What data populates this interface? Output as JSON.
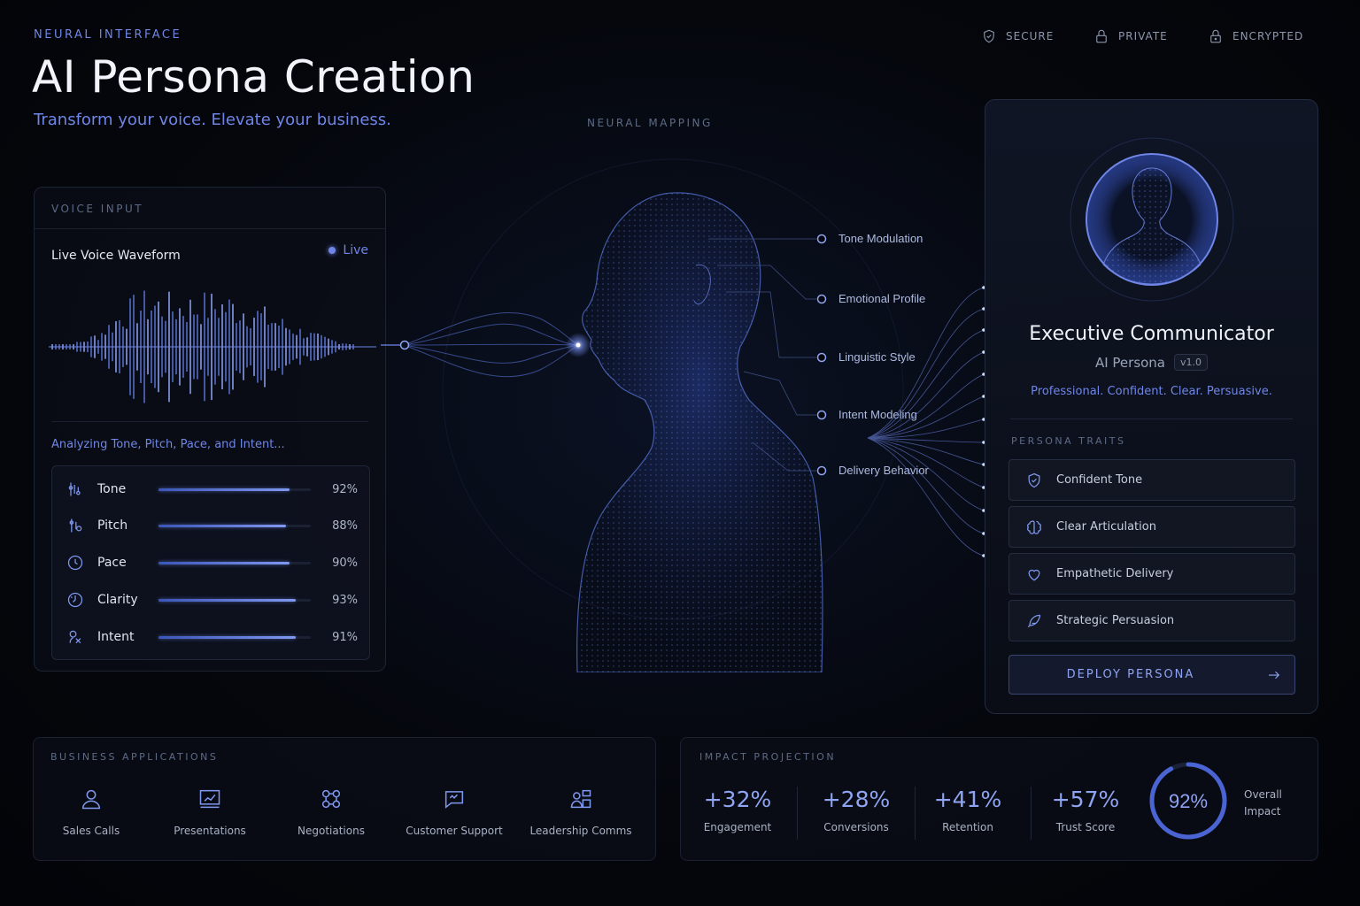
{
  "header": {
    "eyebrow": "NEURAL INTERFACE",
    "title": "AI Persona Creation",
    "subtitle": "Transform your voice. Elevate your business.",
    "badges": [
      {
        "label": "SECURE",
        "icon": "shield-icon"
      },
      {
        "label": "PRIVATE",
        "icon": "lock-icon"
      },
      {
        "label": "ENCRYPTED",
        "icon": "lock-icon"
      }
    ]
  },
  "voice_input": {
    "section_label": "VOICE INPUT",
    "title": "Live Voice Waveform",
    "live_label": "Live",
    "analyzing_text": "Analyzing Tone, Pitch, Pace, and Intent...",
    "metrics": [
      {
        "label": "Tone",
        "value": "92%",
        "level": 0.86,
        "icon": "tuning-icon"
      },
      {
        "label": "Pitch",
        "value": "88%",
        "level": 0.84,
        "icon": "pitch-icon"
      },
      {
        "label": "Pace",
        "value": "90%",
        "level": 0.86,
        "icon": "clock-icon"
      },
      {
        "label": "Clarity",
        "value": "93%",
        "level": 0.9,
        "icon": "clarity-icon"
      },
      {
        "label": "Intent",
        "value": "91%",
        "level": 0.9,
        "icon": "intent-icon"
      }
    ]
  },
  "neural_mapping": {
    "label": "NEURAL MAPPING",
    "nodes": [
      "Tone Modulation",
      "Emotional Profile",
      "Linguistic Style",
      "Intent Modeling",
      "Delivery Behavior"
    ]
  },
  "persona": {
    "name": "Executive Communicator",
    "type": "AI Persona",
    "version": "v1.0",
    "tagline": "Professional. Confident. Clear. Persuasive.",
    "traits_label": "PERSONA TRAITS",
    "traits": [
      {
        "label": "Confident Tone",
        "icon": "shield-check-icon"
      },
      {
        "label": "Clear Articulation",
        "icon": "brain-icon"
      },
      {
        "label": "Empathetic Delivery",
        "icon": "heart-hand-icon"
      },
      {
        "label": "Strategic Persuasion",
        "icon": "feather-icon"
      }
    ],
    "deploy_label": "DEPLOY PERSONA"
  },
  "business_applications": {
    "label": "BUSINESS APPLICATIONS",
    "items": [
      {
        "label": "Sales Calls",
        "icon": "user-icon"
      },
      {
        "label": "Presentations",
        "icon": "presentation-icon"
      },
      {
        "label": "Negotiations",
        "icon": "network-icon"
      },
      {
        "label": "Customer Support",
        "icon": "chat-bubble-icon"
      },
      {
        "label": "Leadership Comms",
        "icon": "leader-icon"
      }
    ]
  },
  "impact_projection": {
    "label": "IMPACT PROJECTION",
    "stats": [
      {
        "value": "+32%",
        "label": "Engagement"
      },
      {
        "value": "+28%",
        "label": "Conversions"
      },
      {
        "value": "+41%",
        "label": "Retention"
      },
      {
        "value": "+57%",
        "label": "Trust Score"
      }
    ],
    "overall_value": "92%",
    "overall_fraction": 0.92,
    "overall_label": "Overall Impact"
  },
  "colors": {
    "accent": "#6f86e6",
    "accent_bright": "#8fa4f2",
    "background": "#05070d"
  }
}
